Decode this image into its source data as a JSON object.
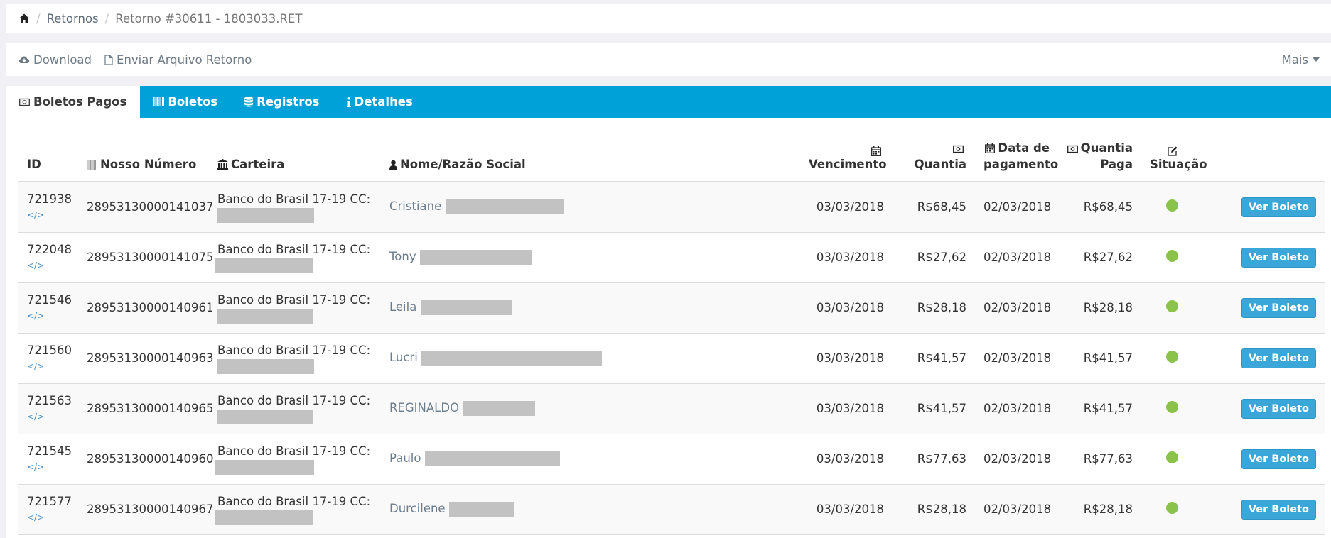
{
  "breadcrumb": {
    "items": [
      "Retornos",
      "Retorno #30611 - 1803033.RET"
    ]
  },
  "toolbar": {
    "download_label": "Download",
    "enviar_label": "Enviar Arquivo Retorno",
    "more_label": "Mais"
  },
  "tabs": [
    {
      "label": "Boletos Pagos",
      "icon": "money-icon",
      "active": true
    },
    {
      "label": "Boletos",
      "icon": "barcode-icon",
      "active": false
    },
    {
      "label": "Registros",
      "icon": "database-icon",
      "active": false
    },
    {
      "label": "Detalhes",
      "icon": "info-icon",
      "active": false
    }
  ],
  "table": {
    "headers": {
      "id": "ID",
      "nosso_numero": "Nosso Número",
      "carteira": "Carteira",
      "nome": "Nome/Razão Social",
      "vencimento": "Vencimento",
      "quantia": "Quantia",
      "data_pagamento_1": "Data de",
      "data_pagamento_2": "pagamento",
      "quantia_paga_1": "Quantia",
      "quantia_paga_2": "Paga",
      "situacao": "Situação"
    },
    "rows": [
      {
        "id": "721938",
        "nosso_numero": "28953130000141037",
        "carteira": "Banco do Brasil 17-19 CC:",
        "nome": "Cristiane",
        "vencimento": "03/03/2018",
        "quantia": "R$68,45",
        "data_pagamento": "02/03/2018",
        "quantia_paga": "R$68,45",
        "button": "Ver Boleto"
      },
      {
        "id": "722048",
        "nosso_numero": "28953130000141075",
        "carteira": "Banco do Brasil 17-19 CC:",
        "nome": "Tony",
        "vencimento": "03/03/2018",
        "quantia": "R$27,62",
        "data_pagamento": "02/03/2018",
        "quantia_paga": "R$27,62",
        "button": "Ver Boleto"
      },
      {
        "id": "721546",
        "nosso_numero": "28953130000140961",
        "carteira": "Banco do Brasil 17-19 CC:",
        "nome": "Leila",
        "vencimento": "03/03/2018",
        "quantia": "R$28,18",
        "data_pagamento": "02/03/2018",
        "quantia_paga": "R$28,18",
        "button": "Ver Boleto"
      },
      {
        "id": "721560",
        "nosso_numero": "28953130000140963",
        "carteira": "Banco do Brasil 17-19 CC:",
        "nome": "Lucri",
        "vencimento": "03/03/2018",
        "quantia": "R$41,57",
        "data_pagamento": "02/03/2018",
        "quantia_paga": "R$41,57",
        "button": "Ver Boleto"
      },
      {
        "id": "721563",
        "nosso_numero": "28953130000140965",
        "carteira": "Banco do Brasil 17-19 CC:",
        "nome": "REGINALDO",
        "vencimento": "03/03/2018",
        "quantia": "R$41,57",
        "data_pagamento": "02/03/2018",
        "quantia_paga": "R$41,57",
        "button": "Ver Boleto"
      },
      {
        "id": "721545",
        "nosso_numero": "28953130000140960",
        "carteira": "Banco do Brasil 17-19 CC:",
        "nome": "Paulo",
        "vencimento": "03/03/2018",
        "quantia": "R$77,63",
        "data_pagamento": "02/03/2018",
        "quantia_paga": "R$77,63",
        "button": "Ver Boleto"
      },
      {
        "id": "721577",
        "nosso_numero": "28953130000140967",
        "carteira": "Banco do Brasil 17-19 CC:",
        "nome": "Durcilene",
        "vencimento": "03/03/2018",
        "quantia": "R$28,18",
        "data_pagamento": "02/03/2018",
        "quantia_paga": "R$28,18",
        "button": "Ver Boleto"
      }
    ]
  },
  "colors": {
    "tab_bar": "#00a0d8",
    "button": "#3ba6d8",
    "status_paid": "#8bc34a",
    "link": "#6a7d8f"
  }
}
